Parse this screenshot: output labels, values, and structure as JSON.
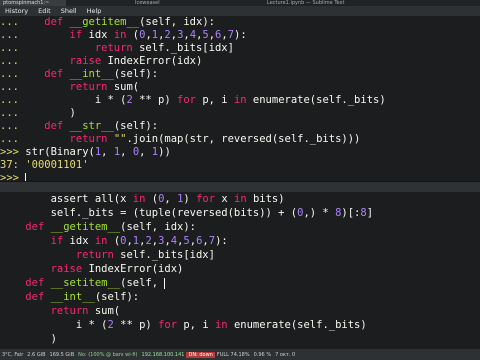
{
  "taskbar": {
    "tabs": [
      "ptomspinmach1:~",
      "",
      "Iceweasel",
      "",
      "Lecture1.ipynb — Sublime Text"
    ]
  },
  "menu": [
    "History",
    "Edit",
    "Shell",
    "Help"
  ],
  "top_pane": {
    "lines": [
      {
        "prompt": "...",
        "indent": "    ",
        "parts": [
          [
            "kw",
            "def "
          ],
          [
            "fn",
            "__getitem__"
          ],
          [
            "t",
            "(self, idx):"
          ]
        ]
      },
      {
        "prompt": "...",
        "indent": "        ",
        "parts": [
          [
            "kw",
            "if "
          ],
          [
            "t",
            "idx "
          ],
          [
            "kw",
            "in "
          ],
          [
            "t",
            "("
          ],
          [
            "num",
            "0"
          ],
          [
            "t",
            ","
          ],
          [
            "num",
            "1"
          ],
          [
            "t",
            ","
          ],
          [
            "num",
            "2"
          ],
          [
            "t",
            ","
          ],
          [
            "num",
            "3"
          ],
          [
            "t",
            ","
          ],
          [
            "num",
            "4"
          ],
          [
            "t",
            ","
          ],
          [
            "num",
            "5"
          ],
          [
            "t",
            ","
          ],
          [
            "num",
            "6"
          ],
          [
            "t",
            ","
          ],
          [
            "num",
            "7"
          ],
          [
            "t",
            "):"
          ]
        ]
      },
      {
        "prompt": "...",
        "indent": "            ",
        "parts": [
          [
            "kw",
            "return "
          ],
          [
            "t",
            "self._bits[idx]"
          ]
        ]
      },
      {
        "prompt": "...",
        "indent": "        ",
        "parts": [
          [
            "kw",
            "raise "
          ],
          [
            "t",
            "IndexError(idx)"
          ]
        ]
      },
      {
        "prompt": "...",
        "indent": "    ",
        "parts": [
          [
            "kw",
            "def "
          ],
          [
            "fn",
            "__int__"
          ],
          [
            "t",
            "(self):"
          ]
        ]
      },
      {
        "prompt": "...",
        "indent": "        ",
        "parts": [
          [
            "kw",
            "return "
          ],
          [
            "t",
            "sum("
          ]
        ]
      },
      {
        "prompt": "...",
        "indent": "            ",
        "parts": [
          [
            "t",
            "i * ("
          ],
          [
            "num",
            "2"
          ],
          [
            "t",
            " ** p) "
          ],
          [
            "kw",
            "for "
          ],
          [
            "t",
            "p, i "
          ],
          [
            "kw",
            "in "
          ],
          [
            "t",
            "enumerate(self._bits)"
          ]
        ]
      },
      {
        "prompt": "...",
        "indent": "        ",
        "parts": [
          [
            "t",
            ")"
          ]
        ]
      },
      {
        "prompt": "...",
        "indent": "    ",
        "parts": [
          [
            "kw",
            "def "
          ],
          [
            "fn",
            "__str__"
          ],
          [
            "t",
            "(self):"
          ]
        ]
      },
      {
        "prompt": "...",
        "indent": "        ",
        "parts": [
          [
            "kw",
            "return "
          ],
          [
            "str",
            "\"\""
          ],
          [
            "t",
            ".join(map(str, reversed(self._bits)))"
          ]
        ]
      },
      {
        "prompt": ">>>",
        "indent": " ",
        "parts": [
          [
            "t",
            "str(Binary("
          ],
          [
            "num",
            "1"
          ],
          [
            "t",
            ", "
          ],
          [
            "num",
            "1"
          ],
          [
            "t",
            ", "
          ],
          [
            "num",
            "0"
          ],
          [
            "t",
            ", "
          ],
          [
            "num",
            "1"
          ],
          [
            "t",
            "))"
          ]
        ]
      },
      {
        "prompt": "37:",
        "indent": " ",
        "parts": [
          [
            "out",
            "'00001101'"
          ]
        ]
      },
      {
        "prompt": ">>>",
        "indent": " ",
        "parts": [
          [
            "cursor",
            ""
          ]
        ]
      }
    ]
  },
  "bottom_pane": {
    "lines": [
      {
        "indent": "        ",
        "parts": [
          [
            "t",
            "assert "
          ],
          [
            "t",
            "all(x "
          ],
          [
            "kw",
            "in "
          ],
          [
            "t",
            "("
          ],
          [
            "num",
            "0"
          ],
          [
            "t",
            ", "
          ],
          [
            "num",
            "1"
          ],
          [
            "t",
            ") "
          ],
          [
            "kw",
            "for "
          ],
          [
            "t",
            "x "
          ],
          [
            "kw",
            "in "
          ],
          [
            "t",
            "bits)"
          ]
        ]
      },
      {
        "indent": "        ",
        "parts": [
          [
            "t",
            "self._bits = (tuple(reversed(bits)) + ("
          ],
          [
            "num",
            "0"
          ],
          [
            "t",
            ",) * "
          ],
          [
            "num",
            "8"
          ],
          [
            "t",
            ")[:"
          ],
          [
            "num",
            "8"
          ],
          [
            "t",
            "]"
          ]
        ]
      },
      {
        "indent": "    ",
        "parts": [
          [
            "kw",
            "def "
          ],
          [
            "fn",
            "__getitem__"
          ],
          [
            "t",
            "(self, idx):"
          ]
        ]
      },
      {
        "indent": "        ",
        "parts": [
          [
            "kw",
            "if "
          ],
          [
            "t",
            "idx "
          ],
          [
            "kw",
            "in "
          ],
          [
            "t",
            "("
          ],
          [
            "num",
            "0"
          ],
          [
            "t",
            ","
          ],
          [
            "num",
            "1"
          ],
          [
            "t",
            ","
          ],
          [
            "num",
            "2"
          ],
          [
            "t",
            ","
          ],
          [
            "num",
            "3"
          ],
          [
            "t",
            ","
          ],
          [
            "num",
            "4"
          ],
          [
            "t",
            ","
          ],
          [
            "num",
            "5"
          ],
          [
            "t",
            ","
          ],
          [
            "num",
            "6"
          ],
          [
            "t",
            ","
          ],
          [
            "num",
            "7"
          ],
          [
            "t",
            "):"
          ]
        ]
      },
      {
        "indent": "            ",
        "parts": [
          [
            "kw",
            "return "
          ],
          [
            "t",
            "self._bits[idx]"
          ]
        ]
      },
      {
        "indent": "        ",
        "parts": [
          [
            "kw",
            "raise "
          ],
          [
            "t",
            "IndexError(idx)"
          ]
        ]
      },
      {
        "indent": "    ",
        "parts": [
          [
            "kw",
            "def "
          ],
          [
            "fn",
            "__setitem__"
          ],
          [
            "t",
            "(self, "
          ],
          [
            "cursor",
            ""
          ]
        ]
      },
      {
        "indent": "    ",
        "parts": [
          [
            "kw",
            "def "
          ],
          [
            "fn",
            "__int__"
          ],
          [
            "t",
            "(self):"
          ]
        ]
      },
      {
        "indent": "        ",
        "parts": [
          [
            "kw",
            "return "
          ],
          [
            "t",
            "sum("
          ]
        ]
      },
      {
        "indent": "            ",
        "parts": [
          [
            "t",
            "i * ("
          ],
          [
            "num",
            "2"
          ],
          [
            "t",
            " ** p) "
          ],
          [
            "kw",
            "for "
          ],
          [
            "t",
            "p, i "
          ],
          [
            "kw",
            "in "
          ],
          [
            "t",
            "enumerate(self._bits)"
          ]
        ]
      },
      {
        "indent": "        ",
        "parts": [
          [
            "t",
            ")"
          ]
        ]
      }
    ]
  },
  "status": {
    "weather": "3°C, Fair",
    "disk1": "2.6 GiB",
    "disk2": "169.5 GiB",
    "wifi": "No: (100% @ bars wi-fi)",
    "ip": "192.168.100.141",
    "dn": "DN: down",
    "battery": "FULL 74.18%",
    "load": "0.96 %",
    "date": "7 окт. 0"
  }
}
